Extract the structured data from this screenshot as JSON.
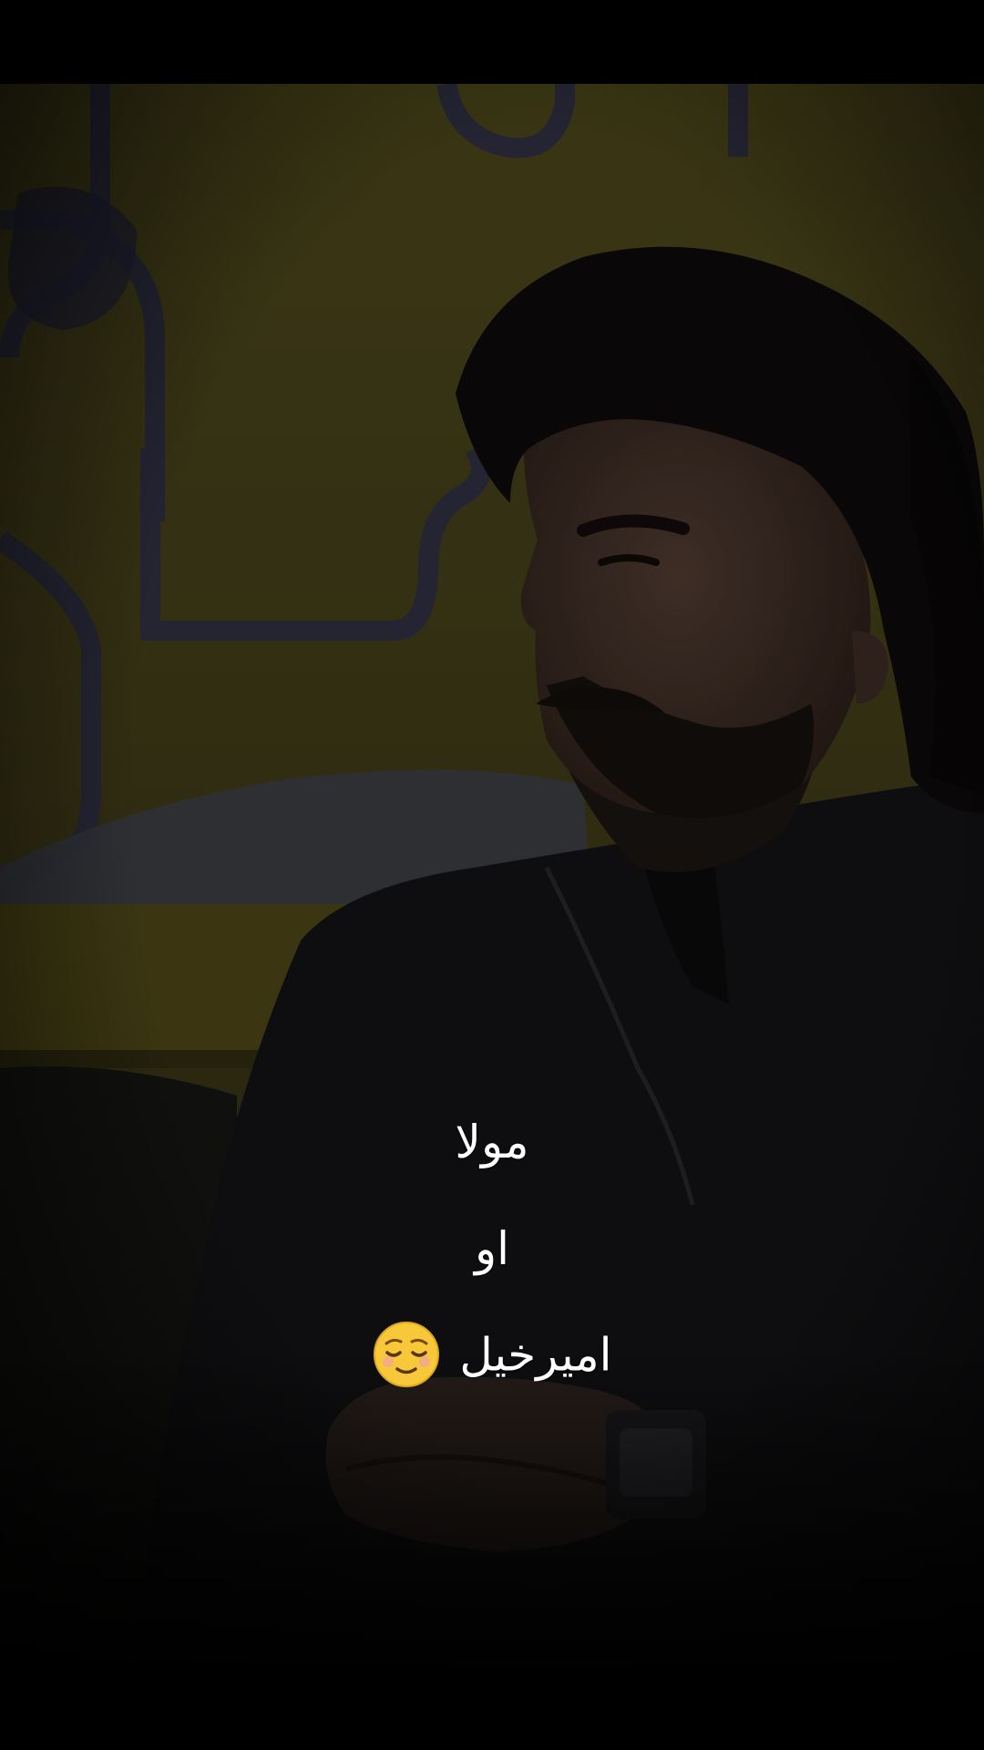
{
  "subtitles": {
    "line1": "مولا",
    "line2": "او",
    "line3": "اميرخيل"
  },
  "icons": {
    "emoji": "relieved-face-icon"
  },
  "colors": {
    "letterbox": "#000000",
    "wall": "#4a4418",
    "subtitle_text": "#ffffff"
  }
}
